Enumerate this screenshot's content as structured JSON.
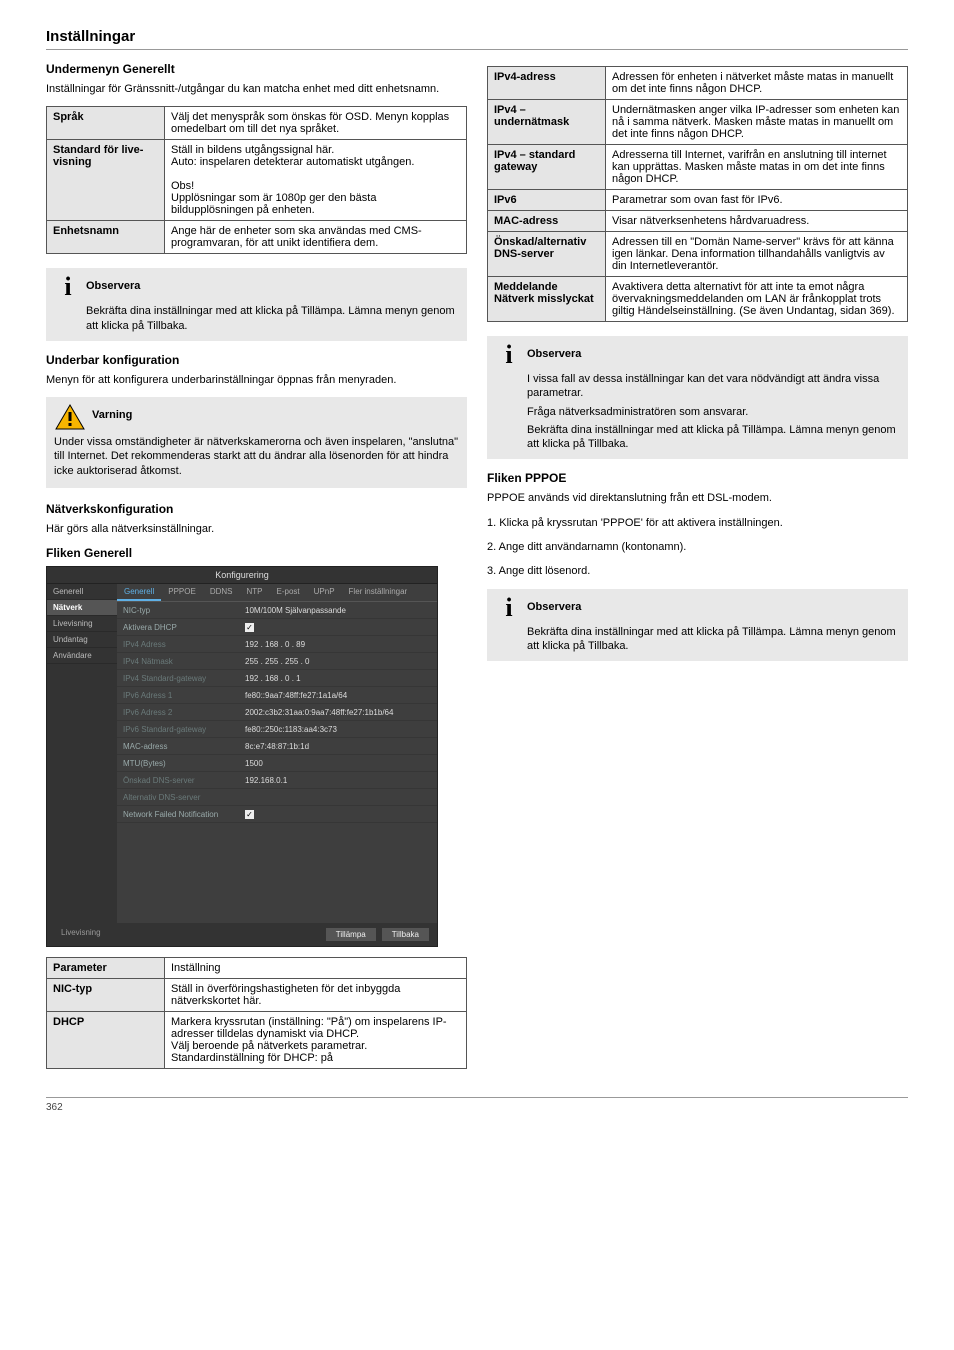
{
  "header": {
    "title": "Inställningar"
  },
  "intro_sub": "Undermenyn Generellt",
  "intro_p": "Inställningar för Gränssnitt-/utgångar du kan matcha enhet med ditt enhetsnamn.",
  "left_table": [
    {
      "k": "Språk",
      "v": "Välj det menyspråk som önskas för OSD. Menyn kopplas omedelbart om till det nya språket."
    },
    {
      "k": "Standard för live-visning",
      "v": "Ställ in bildens utgångssignal här.\nAuto: inspelaren detekterar automatiskt utgången.\n\nObs!\nUpplösningar som är 1080p ger den bästa bildupplösningen på enheten."
    },
    {
      "k": "Enhetsnamn",
      "v": "Ange här de enheter som ska användas med CMS-programvaran, för att unikt identifiera dem."
    }
  ],
  "note1": {
    "title": "Observera",
    "body": "Bekräfta dina inställningar med att klicka på Tillämpa. Lämna menyn genom att klicka på Tillbaka."
  },
  "under_config": {
    "h": "Underbar konfiguration",
    "p": "Menyn för att konfigurera underbarinställningar öppnas från menyraden."
  },
  "warn": {
    "title": "Varning",
    "p1": "Under vissa omständigheter är nätverkskamerorna och även inspelaren, \"anslutna\" till Internet. Det rekommenderas starkt att du ändrar alla lösenorden för att hindra icke auktoriserad åtkomst."
  },
  "netconf": {
    "h": "Nätverkskonfiguration",
    "p": "Här görs alla nätverksinställningar."
  },
  "gen_tab": {
    "h": "Fliken Generell"
  },
  "screenshot": {
    "title": "Konfigurering",
    "side": [
      "Generell",
      "Nätverk",
      "Livevisning",
      "Undantag",
      "Användare"
    ],
    "side_selected": 1,
    "side_bottom": "Livevisning",
    "tabs": [
      "Generell",
      "PPPOE",
      "DDNS",
      "NTP",
      "E-post",
      "UPnP",
      "Fler inställningar"
    ],
    "tab_active": 0,
    "rows": [
      {
        "l": "NIC-typ",
        "v": "10M/100M Självanpassande",
        "dim": false
      },
      {
        "l": "Aktivera DHCP",
        "v": "[x]",
        "dim": false
      },
      {
        "l": "IPv4 Adress",
        "v": "192 . 168 . 0 . 89",
        "dim": true
      },
      {
        "l": "IPv4 Nätmask",
        "v": "255 . 255 . 255 . 0",
        "dim": true
      },
      {
        "l": "IPv4 Standard-gateway",
        "v": "192 . 168 . 0 . 1",
        "dim": true
      },
      {
        "l": "IPv6 Adress 1",
        "v": "fe80::9aa7:48ff:fe27:1a1a/64",
        "dim": true
      },
      {
        "l": "IPv6 Adress 2",
        "v": "2002:c3b2:31aa:0:9aa7:48ff:fe27:1b1b/64",
        "dim": true
      },
      {
        "l": "IPv6 Standard-gateway",
        "v": "fe80::250c:1183:aa4:3c73",
        "dim": true
      },
      {
        "l": "MAC-adress",
        "v": "8c:e7:48:87:1b:1d",
        "dim": false
      },
      {
        "l": "MTU(Bytes)",
        "v": "1500",
        "dim": false
      },
      {
        "l": "Önskad DNS-server",
        "v": "192.168.0.1",
        "dim": true
      },
      {
        "l": "Alternativ DNS-server",
        "v": "",
        "dim": true
      },
      {
        "l": "Network Failed Notification",
        "v": "[x]",
        "dim": false
      }
    ],
    "buttons": [
      "Tillämpa",
      "Tillbaka"
    ]
  },
  "bottom_table": [
    {
      "k": "Parameter",
      "v": "Inställning"
    },
    {
      "k": "NIC-typ",
      "v": "Ställ in överföringshastigheten för det inbyggda nätverkskortet här."
    },
    {
      "k": "DHCP",
      "v": "Markera kryssrutan (inställning: \"På\") om inspelarens IP-adresser tilldelas dynamiskt via DHCP.\nVälj beroende på nätverkets parametrar.\nStandardinställning för DHCP: på"
    }
  ],
  "right_table": [
    {
      "k": "IPv4-adress",
      "v": "Adressen för enheten i nätverket måste matas in manuellt om det inte finns någon DHCP."
    },
    {
      "k": "IPv4 – undernätmask",
      "v": "Undernätmasken anger vilka IP-adresser som enheten kan nå i samma nätverk. Masken måste matas in manuellt om det inte finns någon DHCP."
    },
    {
      "k": "IPv4 – standard gateway",
      "v": "Adresserna till Internet, varifrån en anslutning till internet kan upprättas. Masken måste matas in om det inte finns någon DHCP."
    },
    {
      "k": "IPv6",
      "v": "Parametrar som ovan fast för IPv6."
    },
    {
      "k": "MAC-adress",
      "v": "Visar nätverksenhetens hårdvaruadress."
    },
    {
      "k": "Önskad/alternativ DNS-server",
      "v": "Adressen till en \"Domän Name-server\" krävs för att känna igen länkar. Dena information tillhandahålls vanligtvis av din Internetleverantör."
    },
    {
      "k": "Meddelande Nätverk misslyckat",
      "v": "Avaktivera detta alternativt för att inte ta emot några övervakningsmeddelanden om LAN är frånkopplat trots giltig Händelseinställning. (Se även Undantag, sidan 369)."
    }
  ],
  "note2": {
    "title": "Observera",
    "lines": [
      "I vissa fall av dessa inställningar kan det vara nödvändigt att ändra vissa parametrar.",
      "Fråga nätverksadministratören som ansvarar.",
      "Bekräfta dina inställningar med att klicka på Tillämpa. Lämna menyn genom att klicka på Tillbaka."
    ]
  },
  "pppoe": {
    "h": "Fliken PPPOE",
    "p1": "PPPOE används vid direktanslutning från ett DSL-modem.",
    "steps": [
      "1. Klicka på kryssrutan 'PPPOE' för att aktivera inställningen.",
      "2. Ange ditt användarnamn (kontonamn).",
      "3. Ange ditt lösenord."
    ],
    "note_title": "Observera",
    "note_body": "Bekräfta dina inställningar med att klicka på Tillämpa. Lämna menyn genom att klicka på Tillbaka."
  },
  "footer": "362"
}
